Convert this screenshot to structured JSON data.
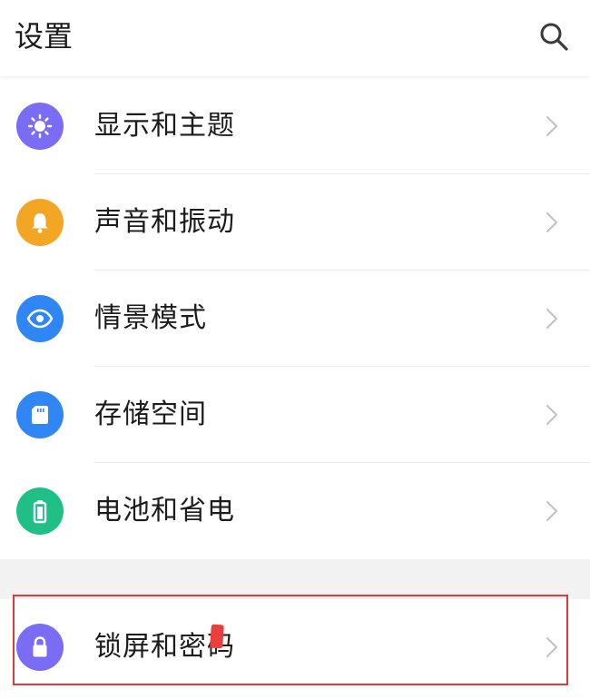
{
  "header": {
    "title": "设置",
    "search_icon": "search-icon"
  },
  "settings": {
    "items": [
      {
        "label": "显示和主题",
        "icon": "brightness-icon",
        "color": "#7b6cf6"
      },
      {
        "label": "声音和振动",
        "icon": "bell-icon",
        "color": "#f2a623"
      },
      {
        "label": "情景模式",
        "icon": "eye-icon",
        "color": "#2f86f4"
      },
      {
        "label": "存储空间",
        "icon": "sd-card-icon",
        "color": "#2f86f4"
      },
      {
        "label": "电池和省电",
        "icon": "battery-icon",
        "color": "#1fbf86"
      },
      {
        "label": "锁屏和密码",
        "icon": "lock-icon",
        "color": "#7b6cf6"
      }
    ]
  },
  "colors": {
    "background": "#ffffff",
    "section_gap": "#f2f2f2",
    "divider": "#ececec",
    "chevron": "#c4c4c4",
    "highlight_box": "#e23a3a"
  }
}
